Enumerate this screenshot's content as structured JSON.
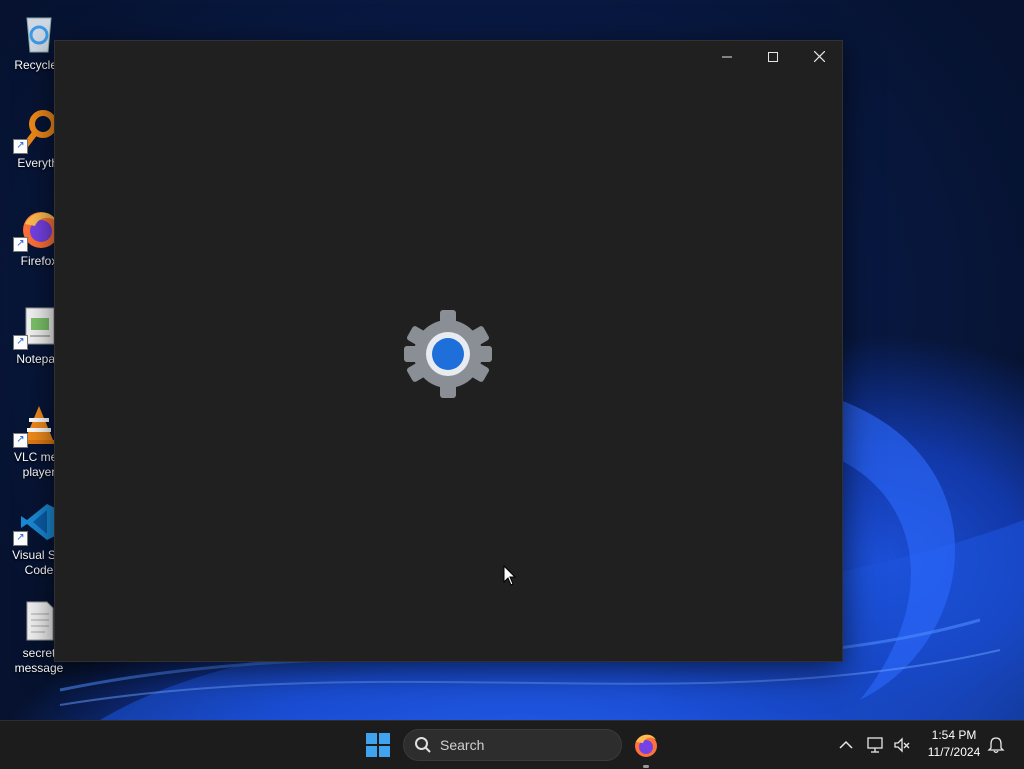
{
  "desktop": {
    "icons": [
      {
        "label": "Recycle I",
        "icon": "recycle-bin-icon"
      },
      {
        "label": "Everythi",
        "icon": "everything-search-icon"
      },
      {
        "label": "Firefox",
        "icon": "firefox-icon"
      },
      {
        "label": "Notepad",
        "icon": "notepad-icon"
      },
      {
        "label": "VLC med player",
        "icon": "vlc-icon"
      },
      {
        "label": "Visual Stu Code",
        "icon": "vscode-icon"
      },
      {
        "label": "secret message",
        "icon": "text-file-icon"
      }
    ]
  },
  "window": {
    "buttons": {
      "minimize": "—",
      "maximize": "☐",
      "close": "✕"
    },
    "splash_icon": "settings-gear-icon"
  },
  "taskbar": {
    "search_placeholder": "Search",
    "pinned": [
      {
        "name": "Firefox",
        "icon": "firefox-icon",
        "running": true
      }
    ],
    "tray": {
      "time": "1:54 PM",
      "date": "11/7/2024"
    }
  },
  "colors": {
    "window_bg": "#202020",
    "taskbar_bg": "#1c1c1c",
    "accent": "#1e6fd9"
  }
}
